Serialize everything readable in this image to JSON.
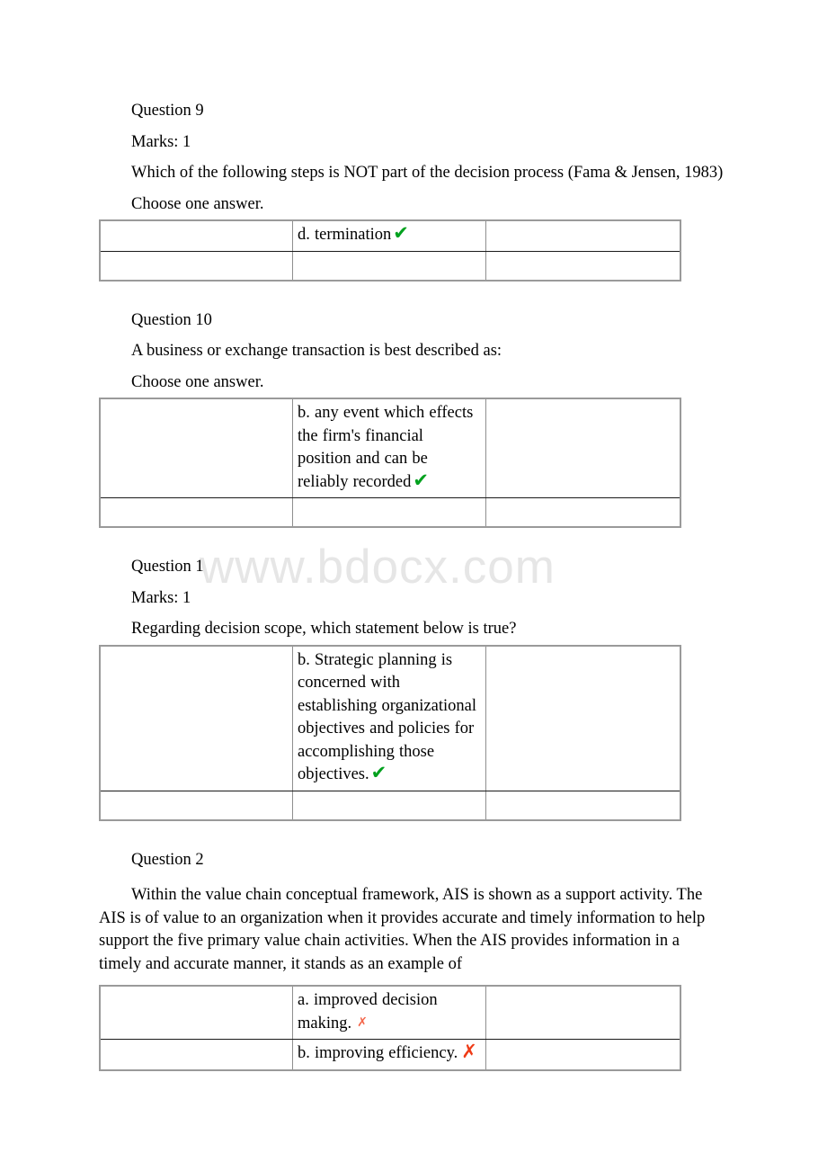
{
  "watermark": {
    "text": "www.bdocx.com",
    "color": "#e6e6e6"
  },
  "marks": {
    "correct_glyph": "✔",
    "incorrect_glyph": "✗",
    "correct_color": "#00a11e",
    "incorrect_color_light": "#f4664a",
    "incorrect_color_bold": "#ef3b16"
  },
  "questions": [
    {
      "heading": "Question 9",
      "marks_label": "Marks: 1",
      "stem": "Which of the following steps is NOT part of the decision process (Fama & Jensen, 1983)",
      "choose_label": "Choose one answer.",
      "options": [
        {
          "text": "d. termination",
          "result": "correct"
        }
      ]
    },
    {
      "heading": "Question 10",
      "marks_label": "",
      "stem": "A business or exchange transaction is best described as:",
      "choose_label": "Choose one answer.",
      "options": [
        {
          "text": "b. any event which effects the firm's financial position and can be reliably recorded",
          "result": "correct"
        }
      ]
    },
    {
      "heading": "Question 1",
      "marks_label": "Marks: 1",
      "stem": "Regarding decision scope, which statement below is true?",
      "choose_label": "",
      "options": [
        {
          "text": "b. Strategic planning is concerned with establishing organizational objectives and policies for accomplishing those objectives.",
          "result": "correct"
        }
      ]
    },
    {
      "heading": "Question 2",
      "marks_label": "",
      "stem": "Within the value chain conceptual framework, AIS is shown as a support activity. The AIS is of value to an organization when it provides accurate and timely information to help support the five primary value chain activities. When the AIS provides information in a timely and accurate manner, it stands as an example of",
      "choose_label": "",
      "options": [
        {
          "text": "a. improved decision making.",
          "result": "incorrect_light"
        },
        {
          "text": "b. improving efficiency.",
          "result": "incorrect_bold"
        }
      ]
    }
  ]
}
